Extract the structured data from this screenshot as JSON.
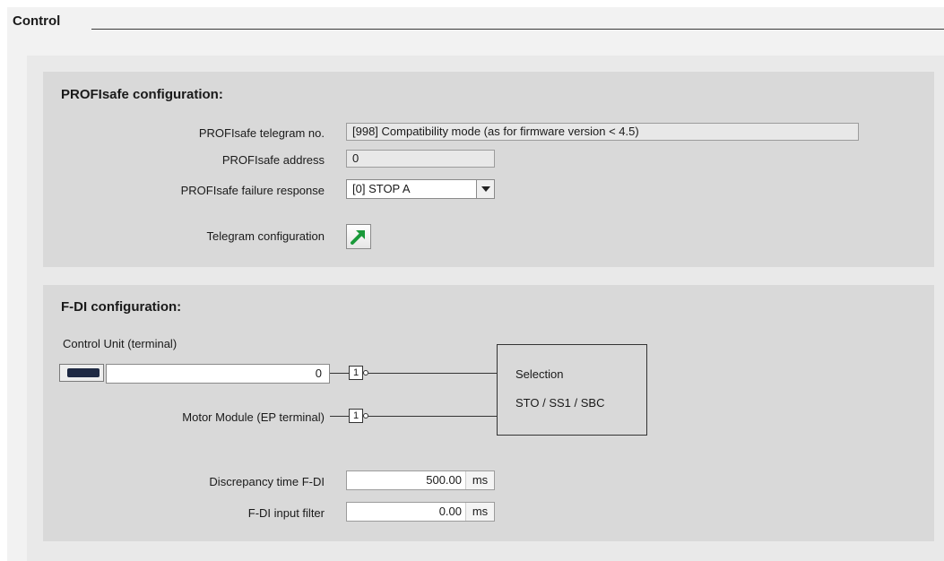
{
  "header": {
    "title": "Control"
  },
  "profisafe": {
    "title": "PROFIsafe configuration:",
    "telegram_no_label": "PROFIsafe telegram no.",
    "telegram_no_value": "[998] Compatibility mode (as for firmware version < 4.5)",
    "address_label": "PROFIsafe address",
    "address_value": "0",
    "failure_label": "PROFIsafe failure response",
    "failure_value": "[0] STOP A",
    "telegram_config_label": "Telegram configuration",
    "telegram_config_icon": "green-arrow-icon"
  },
  "fdi": {
    "title": "F-DI configuration:",
    "control_unit_label": "Control Unit (terminal)",
    "terminal_value": "0",
    "motor_module_label": "Motor Module (EP terminal)",
    "gate_symbol": "1",
    "selection_label": "Selection",
    "selection_functions": "STO / SS1 / SBC",
    "discrepancy_label": "Discrepancy time F-DI",
    "discrepancy_value": "500.00",
    "discrepancy_unit": "ms",
    "input_filter_label": "F-DI input filter",
    "input_filter_value": "0.00",
    "input_filter_unit": "ms"
  }
}
